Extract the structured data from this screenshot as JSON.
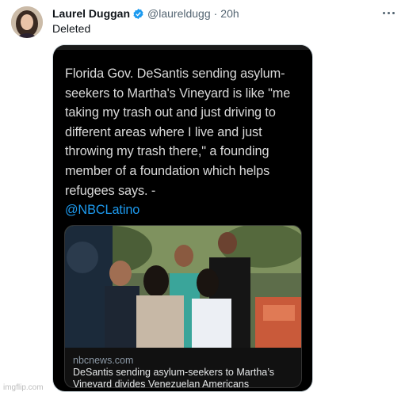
{
  "tweet": {
    "author_name": "Laurel Duggan",
    "handle": "@laureldugg",
    "separator": "·",
    "time": "20h",
    "text": "Deleted"
  },
  "embedded_screenshot": {
    "text_main": "Florida Gov. DeSantis sending asylum-seekers to Martha's Vineyard is like \"me taking my trash out and just driving to different areas where I live and just throwing my trash there,\" a founding member of a foundation which helps refugees says. -",
    "mention": "@NBCLatino",
    "link_card": {
      "domain": "nbcnews.com",
      "title": "DeSantis sending asylum-seekers to Martha’s Vineyard divides Venezuelan Americans"
    }
  },
  "watermark": "imgflip.com",
  "colors": {
    "verified_badge": "#1d9bf0",
    "mention": "#1d9bf0",
    "embed_background": "#000000"
  },
  "icons": [
    "verified-badge-icon",
    "more-options-icon"
  ]
}
